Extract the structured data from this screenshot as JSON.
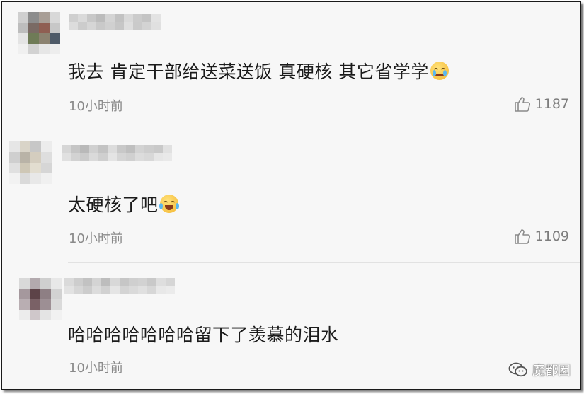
{
  "comments": [
    {
      "text": "我去 肯定干部给送菜送饭 真硬核 其它省学学",
      "emoji": "crying-face",
      "time": "10小时前",
      "likes": "1187"
    },
    {
      "text": "太硬核了吧",
      "emoji": "tears-of-joy-face",
      "time": "10小时前",
      "likes": "1109"
    },
    {
      "text": "哈哈哈哈哈哈哈留下了羡慕的泪水",
      "emoji": "",
      "time": "10小时前",
      "likes": ""
    }
  ],
  "watermark": {
    "label": "魔都囡",
    "icon": "wechat-icon"
  },
  "colors": {
    "background": "#f7f7f7",
    "text": "#1b1b1b",
    "meta": "#8a8a8a",
    "divider": "#e2e2e2"
  }
}
